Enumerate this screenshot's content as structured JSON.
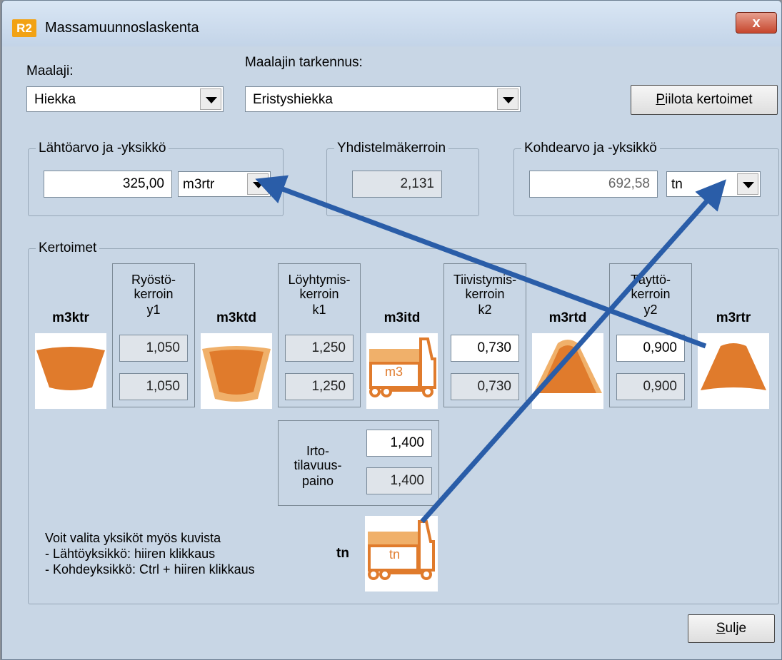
{
  "window": {
    "title": "Massamuunnoslaskenta",
    "icon_text": "R2",
    "close_glyph": "x"
  },
  "soil": {
    "label": "Maalaji:",
    "value": "Hiekka"
  },
  "soil_detail": {
    "label": "Maalajin tarkennus:",
    "value": "Eristyshiekka"
  },
  "hide_button": {
    "label_first": "P",
    "label_rest": "iilota kertoimet"
  },
  "source": {
    "group_label": "Lähtöarvo ja -yksikkö",
    "value": "325,00",
    "unit": "m3rtr"
  },
  "combined": {
    "group_label": "Yhdistelmäkerroin",
    "value": "2,131"
  },
  "target": {
    "group_label": "Kohdearvo ja -yksikkö",
    "value": "692,58",
    "unit": "tn"
  },
  "coefficients": {
    "group_label": "Kertoimet",
    "units": [
      "m3ktr",
      "m3ktd",
      "m3itd",
      "m3rtd",
      "m3rtr"
    ],
    "truck_m3_text": "m3",
    "factors": [
      {
        "line1": "Ryöstö-",
        "line2": "kerroin",
        "line3": "y1",
        "value": "1,050",
        "default": "1,050"
      },
      {
        "line1": "Löyhtymis-",
        "line2": "kerroin",
        "line3": "k1",
        "value": "1,250",
        "default": "1,250"
      },
      {
        "line1": "Tiivistymis-",
        "line2": "kerroin",
        "line3": "k2",
        "value": "0,730",
        "default": "0,730"
      },
      {
        "line1": "Täyttö-",
        "line2": "kerroin",
        "line3": "y2",
        "value": "0,900",
        "default": "0,900"
      }
    ],
    "density": {
      "line1": "Irto-",
      "line2": "tilavuus-",
      "line3": "paino",
      "value": "1,400",
      "default": "1,400"
    },
    "tn_label": "tn",
    "truck_tn_text": "tn"
  },
  "hint": {
    "line1": "Voit valita yksiköt myös kuvista",
    "line2": "- Lähtöyksikkö: hiiren klikkaus",
    "line3": "- Kohdeyksikkö: Ctrl + hiiren klikkaus"
  },
  "close_button": {
    "label_first": "S",
    "label_rest": "ulje"
  },
  "colors": {
    "soil": "#e07b2c",
    "soil_light": "#f0b06a",
    "arrow": "#2a5da8",
    "window_bg": "#c8d6e5"
  }
}
